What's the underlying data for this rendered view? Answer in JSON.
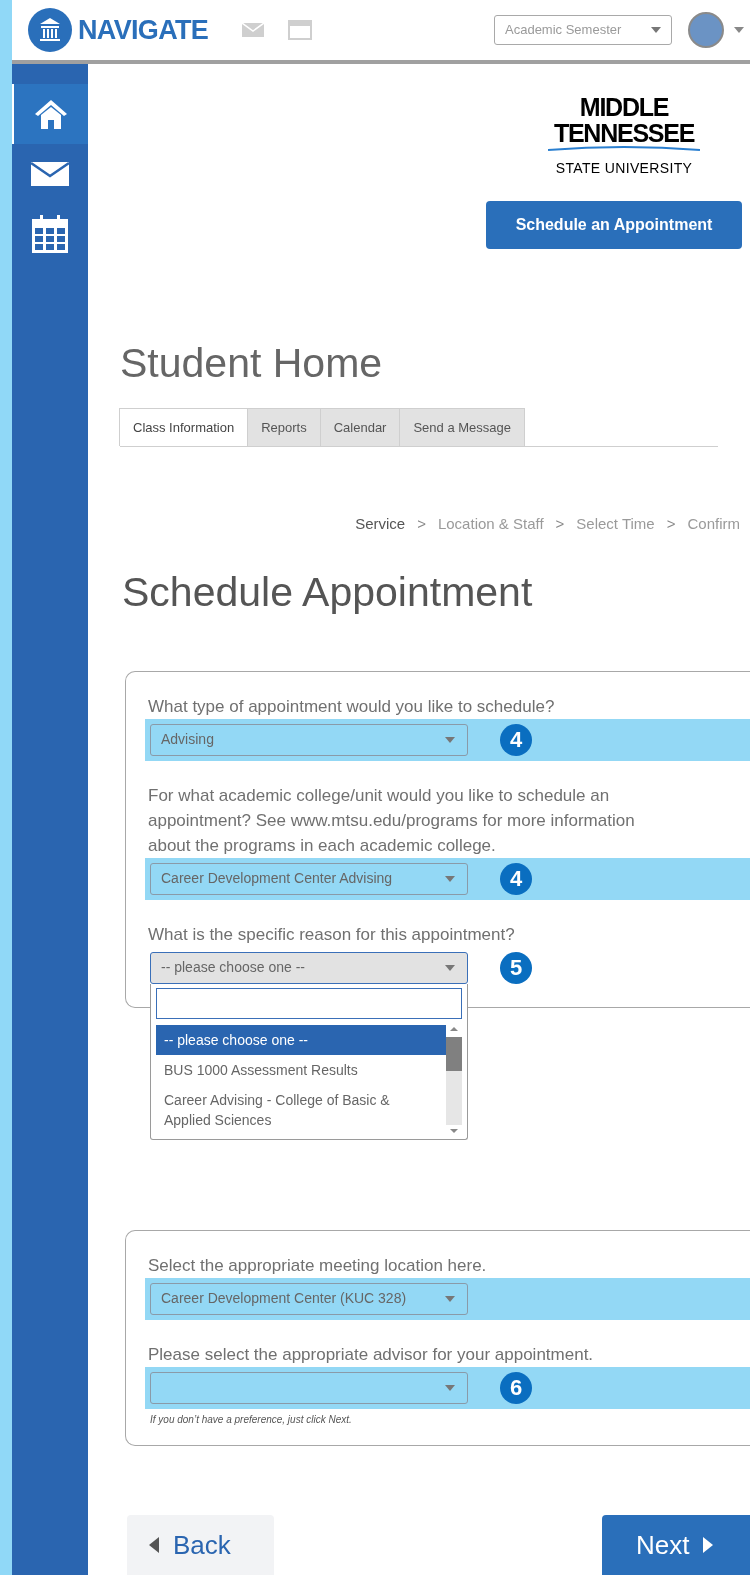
{
  "header": {
    "brand": "NAVIGATE",
    "semester_select": {
      "value": "Academic Semester"
    }
  },
  "sidebar": {
    "items": [
      {
        "kind": "home",
        "selected": true
      },
      {
        "kind": "mail",
        "selected": false
      },
      {
        "kind": "calendar",
        "selected": false
      }
    ]
  },
  "logo": {
    "lines": [
      "MIDDLE",
      "TENNESSEE",
      "STATE UNIVERSITY"
    ]
  },
  "schedule_button": "Schedule an Appointment",
  "page_title": "Student Home",
  "tabs": [
    {
      "label": "Class Information",
      "selected": true
    },
    {
      "label": "Reports",
      "selected": false
    },
    {
      "label": "Calendar",
      "selected": false
    },
    {
      "label": "Send a Message",
      "selected": false
    }
  ],
  "breadcrumb": [
    {
      "label": "Service",
      "current": true
    },
    {
      "label": "Location & Staff",
      "current": false
    },
    {
      "label": "Select Time",
      "current": false
    },
    {
      "label": "Confirm",
      "current": false
    }
  ],
  "breadcrumb_separator": ">",
  "form_title": "Schedule Appointment",
  "cards": [
    {
      "questions": [
        {
          "label": "What type of appointment would you like to schedule?",
          "value": "Advising",
          "highlighted": true,
          "badge": "4",
          "open": false
        },
        {
          "label": "For what academic college/unit would you like to schedule an appointment? See www.mtsu.edu/programs for more information about the programs in each academic college.",
          "value": "Career Development Center Advising",
          "highlighted": true,
          "badge": "4",
          "open": false
        },
        {
          "label": "What is the specific reason for this appointment?",
          "value": "-- please choose one --",
          "highlighted": false,
          "badge": "5",
          "open": true,
          "options": [
            {
              "label": "-- please choose one --",
              "selected": true
            },
            {
              "label": "BUS 1000 Assessment Results",
              "selected": false
            },
            {
              "label": "Career Advising - College of Basic & Applied Sciences",
              "selected": false
            }
          ]
        }
      ]
    },
    {
      "questions": [
        {
          "label": "Select the appropriate meeting location here.",
          "value": "Career Development Center (KUC 328)",
          "highlighted": true,
          "open": false
        },
        {
          "label": "Please select the appropriate advisor for your appointment.",
          "highlighted": true,
          "badge": "6",
          "open": false,
          "hint": "If you don’t have a preference, just click Next."
        }
      ]
    }
  ],
  "back_button": "Back",
  "next_button": "Next"
}
